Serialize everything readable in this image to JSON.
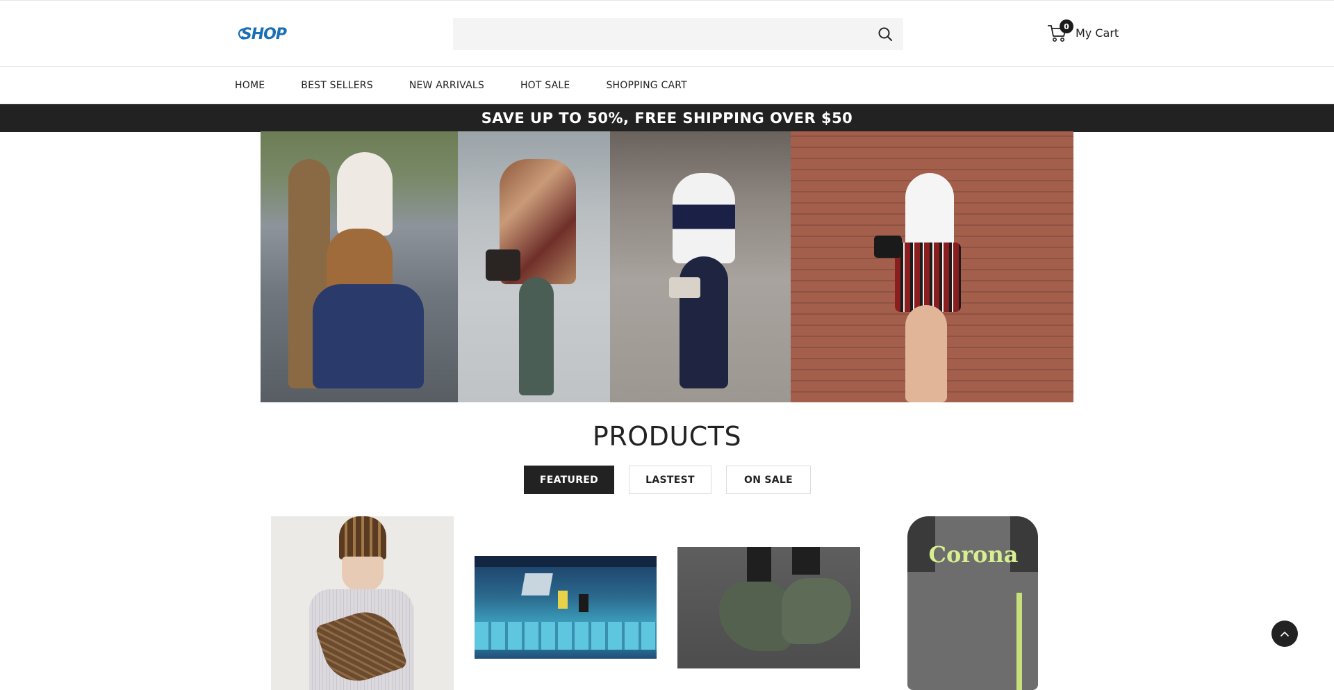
{
  "header": {
    "logo_text": "SHOP",
    "search": {
      "value": "",
      "placeholder": ""
    },
    "cart": {
      "count": "0",
      "label": "My Cart"
    }
  },
  "nav": {
    "items": [
      {
        "label": "HOME"
      },
      {
        "label": "BEST SELLERS"
      },
      {
        "label": "NEW ARRIVALS"
      },
      {
        "label": "HOT SALE"
      },
      {
        "label": "SHOPPING CART"
      }
    ]
  },
  "promo": {
    "text": "SAVE UP TO 50%, FREE SHIPPING OVER $50"
  },
  "products": {
    "title": "PRODUCTS",
    "tabs": [
      {
        "label": "FEATURED",
        "active": true
      },
      {
        "label": "LASTEST",
        "active": false
      },
      {
        "label": "ON SALE",
        "active": false
      }
    ],
    "items": [
      {
        "image": "beanie-and-bag-photo"
      },
      {
        "image": "lego-game-screenshot"
      },
      {
        "image": "green-sneakers-photo"
      },
      {
        "image": "corona-jersey-photo",
        "print": "Corona"
      }
    ]
  },
  "colors": {
    "brand": "#1a6fb5",
    "dark": "#222222",
    "search_bg": "#f4f4f4"
  },
  "icons": {
    "search": "search-icon",
    "cart": "cart-icon",
    "scroll_top": "chevron-up-icon"
  }
}
